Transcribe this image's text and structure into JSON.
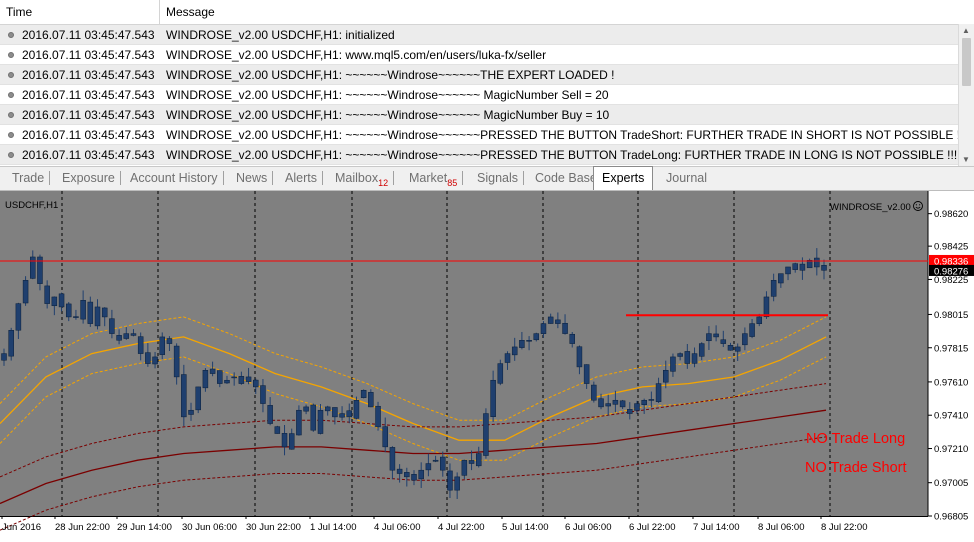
{
  "log": {
    "columns": {
      "time": "Time",
      "message": "Message"
    },
    "rows": [
      {
        "time": "2016.07.11 03:45:47.543",
        "message": "WINDROSE_v2.00 USDCHF,H1: initialized"
      },
      {
        "time": "2016.07.11 03:45:47.543",
        "message": "WINDROSE_v2.00 USDCHF,H1: www.mql5.com/en/users/luka-fx/seller"
      },
      {
        "time": "2016.07.11 03:45:47.543",
        "message": "WINDROSE_v2.00 USDCHF,H1: ~~~~~~Windrose~~~~~~THE EXPERT LOADED !"
      },
      {
        "time": "2016.07.11 03:45:47.543",
        "message": "WINDROSE_v2.00 USDCHF,H1: ~~~~~~Windrose~~~~~~ MagicNumber Sell = 20"
      },
      {
        "time": "2016.07.11 03:45:47.543",
        "message": "WINDROSE_v2.00 USDCHF,H1: ~~~~~~Windrose~~~~~~ MagicNumber Buy = 10"
      },
      {
        "time": "2016.07.11 03:45:47.543",
        "message": "WINDROSE_v2.00 USDCHF,H1: ~~~~~~Windrose~~~~~~PRESSED THE BUTTON  TradeShort: FURTHER TRADE IN SHORT IS NOT POSSIBLE !!!"
      },
      {
        "time": "2016.07.11 03:45:47.543",
        "message": "WINDROSE_v2.00 USDCHF,H1: ~~~~~~Windrose~~~~~~PRESSED THE BUTTON  TradeLong: FURTHER TRADE IN LONG IS NOT POSSIBLE !!!"
      }
    ]
  },
  "tabs": [
    {
      "label": "Trade"
    },
    {
      "label": "Exposure"
    },
    {
      "label": "Account History"
    },
    {
      "label": "News"
    },
    {
      "label": "Alerts"
    },
    {
      "label": "Mailbox",
      "badge": "12"
    },
    {
      "label": "Market",
      "badge": "85"
    },
    {
      "label": "Signals"
    },
    {
      "label": "Code Base"
    },
    {
      "label": "Experts",
      "active": true
    },
    {
      "label": "Journal"
    }
  ],
  "chart": {
    "symbol_label": "USDCHF,H1",
    "expert_label": "WINDROSE_v2.00",
    "expert_icon": "smiley-icon",
    "status_long": "NO Trade Long",
    "status_short": "NO Trade Short",
    "colors": {
      "background": "#808080",
      "candle": "#1f3f6e",
      "red_line": "#ff0000",
      "ma_inner": "#f5a500",
      "ma_outer": "#7a0000",
      "status_text": "#ff0000",
      "grid": "#000000"
    }
  },
  "chart_data": {
    "type": "candlestick",
    "symbol": "USDCHF",
    "timeframe": "H1",
    "price_ticks": [
      "0.98620",
      "0.98425",
      "0.98225",
      "0.98015",
      "0.97815",
      "0.97610",
      "0.97410",
      "0.97210",
      "0.97005",
      "0.96805"
    ],
    "time_ticks": [
      "Jun 2016",
      "28 Jun 22:00",
      "29 Jun 14:00",
      "30 Jun 06:00",
      "30 Jun 22:00",
      "1 Jul 14:00",
      "4 Jul 06:00",
      "4 Jul 22:00",
      "5 Jul 14:00",
      "6 Jul 06:00",
      "6 Jul 22:00",
      "7 Jul 14:00",
      "8 Jul 06:00",
      "8 Jul 22:00"
    ],
    "ylim": [
      0.96805,
      0.9872
    ],
    "bid_line": {
      "price": 0.98336,
      "label": "0.98336"
    },
    "current_price": {
      "price": 0.98276,
      "label": "0.98276"
    },
    "level_line": 0.9801,
    "close_path": [
      0.9778,
      0.9792,
      0.9808,
      0.9822,
      0.9836,
      0.982,
      0.9808,
      0.9812,
      0.9806,
      0.98,
      0.98,
      0.981,
      0.9796,
      0.9806,
      0.98,
      0.979,
      0.9786,
      0.979,
      0.979,
      0.9778,
      0.9772,
      0.9776,
      0.9788,
      0.9784,
      0.9764,
      0.974,
      0.9744,
      0.9758,
      0.9768,
      0.9766,
      0.976,
      0.9762,
      0.9764,
      0.976,
      0.9764,
      0.9758,
      0.9748,
      0.9736,
      0.973,
      0.9722,
      0.973,
      0.9744,
      0.9746,
      0.9732,
      0.9744,
      0.9746,
      0.974,
      0.9742,
      0.974,
      0.975,
      0.9756,
      0.9746,
      0.9734,
      0.9722,
      0.9708,
      0.9706,
      0.9704,
      0.9702,
      0.9708,
      0.9712,
      0.9714,
      0.9708,
      0.9696,
      0.9704,
      0.9714,
      0.9712,
      0.9718,
      0.9742,
      0.9762,
      0.9772,
      0.9778,
      0.9782,
      0.9786,
      0.9786,
      0.979,
      0.9796,
      0.98,
      0.9796,
      0.979,
      0.9784,
      0.977,
      0.976,
      0.975,
      0.9746,
      0.9748,
      0.975,
      0.9746,
      0.9742,
      0.9748,
      0.975,
      0.975,
      0.976,
      0.9768,
      0.9776,
      0.9778,
      0.9772,
      0.9778,
      0.9784,
      0.979,
      0.9788,
      0.9784,
      0.978,
      0.9782,
      0.979,
      0.9796,
      0.98,
      0.9812,
      0.9822,
      0.9826,
      0.983,
      0.9832,
      0.9828,
      0.9834,
      0.983,
      0.9828
    ],
    "overlays": [
      {
        "name": "inner-band",
        "style": "solid",
        "points": [
          0.9736,
          0.9764,
          0.9778,
          0.9784,
          0.9788,
          0.9778,
          0.9766,
          0.9758,
          0.9748,
          0.9736,
          0.9726,
          0.9726,
          0.974,
          0.9752,
          0.9758,
          0.976,
          0.9764,
          0.9774,
          0.9788
        ]
      },
      {
        "name": "inner-band-upper",
        "style": "dashed",
        "points": [
          0.9748,
          0.9776,
          0.979,
          0.9796,
          0.98,
          0.979,
          0.9778,
          0.977,
          0.976,
          0.9748,
          0.9738,
          0.9738,
          0.9752,
          0.9764,
          0.977,
          0.9772,
          0.9776,
          0.9786,
          0.98
        ]
      },
      {
        "name": "inner-band-lower",
        "style": "dashed",
        "points": [
          0.9724,
          0.9752,
          0.9766,
          0.9772,
          0.9776,
          0.9766,
          0.9754,
          0.9746,
          0.9736,
          0.9724,
          0.9714,
          0.9714,
          0.9728,
          0.974,
          0.9746,
          0.9748,
          0.9752,
          0.9762,
          0.9776
        ]
      },
      {
        "name": "outer-band",
        "style": "solid",
        "points": [
          0.9688,
          0.97,
          0.9708,
          0.9714,
          0.9718,
          0.972,
          0.9722,
          0.9722,
          0.972,
          0.9718,
          0.9718,
          0.972,
          0.9722,
          0.9724,
          0.9728,
          0.9732,
          0.9736,
          0.974,
          0.9744
        ]
      },
      {
        "name": "outer-band-upper",
        "style": "dashed",
        "points": [
          0.9704,
          0.9716,
          0.9724,
          0.973,
          0.9734,
          0.9736,
          0.9738,
          0.9738,
          0.9736,
          0.9734,
          0.9734,
          0.9736,
          0.9738,
          0.974,
          0.9744,
          0.9748,
          0.9752,
          0.9756,
          0.976
        ]
      },
      {
        "name": "outer-band-lower",
        "style": "dashed",
        "points": [
          0.9672,
          0.9684,
          0.9692,
          0.9698,
          0.9702,
          0.9704,
          0.9706,
          0.9706,
          0.9704,
          0.9702,
          0.9702,
          0.9704,
          0.9706,
          0.9708,
          0.9712,
          0.9716,
          0.972,
          0.9724,
          0.9728
        ]
      }
    ]
  }
}
